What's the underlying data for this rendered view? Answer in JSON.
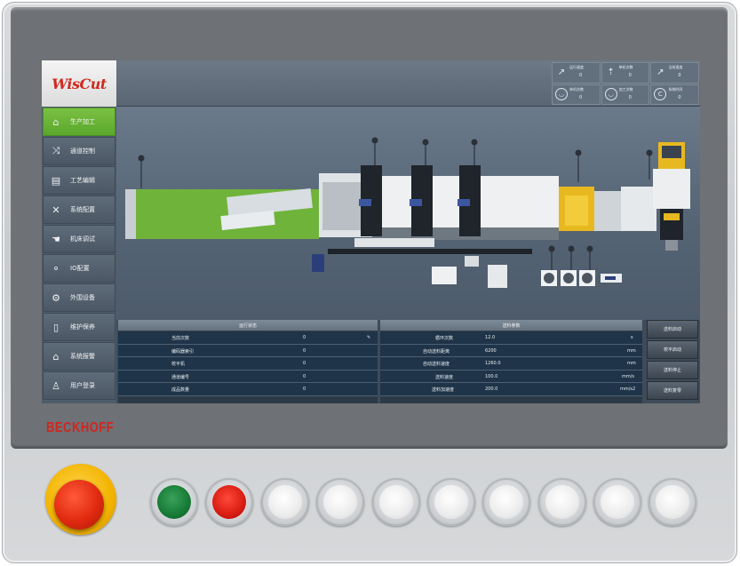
{
  "brand": "BECKHOFF",
  "app": {
    "logo_text": "WisCut"
  },
  "topbar": {
    "stats": [
      {
        "label": "运行速度",
        "value": "0",
        "icon": "speed-icon"
      },
      {
        "label": "单机次数",
        "value": "0",
        "icon": "counter-icon"
      },
      {
        "label": "当前速度",
        "value": "0",
        "icon": "gauge-icon"
      },
      {
        "label": "单机次数",
        "value": "0",
        "icon": "clock-icon"
      },
      {
        "label": "加工次数",
        "value": "0",
        "icon": "timer-icon"
      },
      {
        "label": "系统时间",
        "value": "0",
        "icon": "copyright-icon"
      }
    ]
  },
  "sidebar": {
    "items": [
      {
        "label": "生产加工",
        "icon": "home-icon",
        "active": true
      },
      {
        "label": "通道控制",
        "icon": "shuffle-icon",
        "active": false
      },
      {
        "label": "工艺编辑",
        "icon": "document-icon",
        "active": false
      },
      {
        "label": "系统配置",
        "icon": "tools-icon",
        "active": false
      },
      {
        "label": "机床调试",
        "icon": "hand-icon",
        "active": false
      },
      {
        "label": "IO配置",
        "icon": "io-icon",
        "active": false
      },
      {
        "label": "外围设备",
        "icon": "gear-icon",
        "active": false
      },
      {
        "label": "维护保养",
        "icon": "phone-icon",
        "active": false
      },
      {
        "label": "系统报警",
        "icon": "bell-icon",
        "active": false
      },
      {
        "label": "用户登录",
        "icon": "user-icon",
        "active": false
      }
    ]
  },
  "left_table": {
    "title": "运行状态",
    "rows": [
      {
        "label": "当前次数",
        "value": "0"
      },
      {
        "label": "编码器索引",
        "value": "0"
      },
      {
        "label": "校平机",
        "value": "0"
      },
      {
        "label": "通道编号",
        "value": "0"
      },
      {
        "label": "成品数量",
        "value": "0"
      }
    ]
  },
  "right_table": {
    "title": "送料参数",
    "rows": [
      {
        "label": "循环次数",
        "value": "12.0",
        "unit": "s"
      },
      {
        "label": "自动送料距离",
        "value": "6200",
        "unit": "mm"
      },
      {
        "label": "自动送料速度",
        "value": "1260.0",
        "unit": "mm"
      },
      {
        "label": "送料速度",
        "value": "100.0",
        "unit": "mm/s"
      },
      {
        "label": "送料加速度",
        "value": "200.0",
        "unit": "mm/s2"
      }
    ]
  },
  "action_buttons": [
    "送料启动",
    "校平启动",
    "送料停止",
    "送料复零"
  ],
  "colors": {
    "accent_green": "#6db83a",
    "logo_red": "#cf2a1e",
    "brand_red": "#d1251f",
    "estop_yellow": "#f2b300"
  }
}
